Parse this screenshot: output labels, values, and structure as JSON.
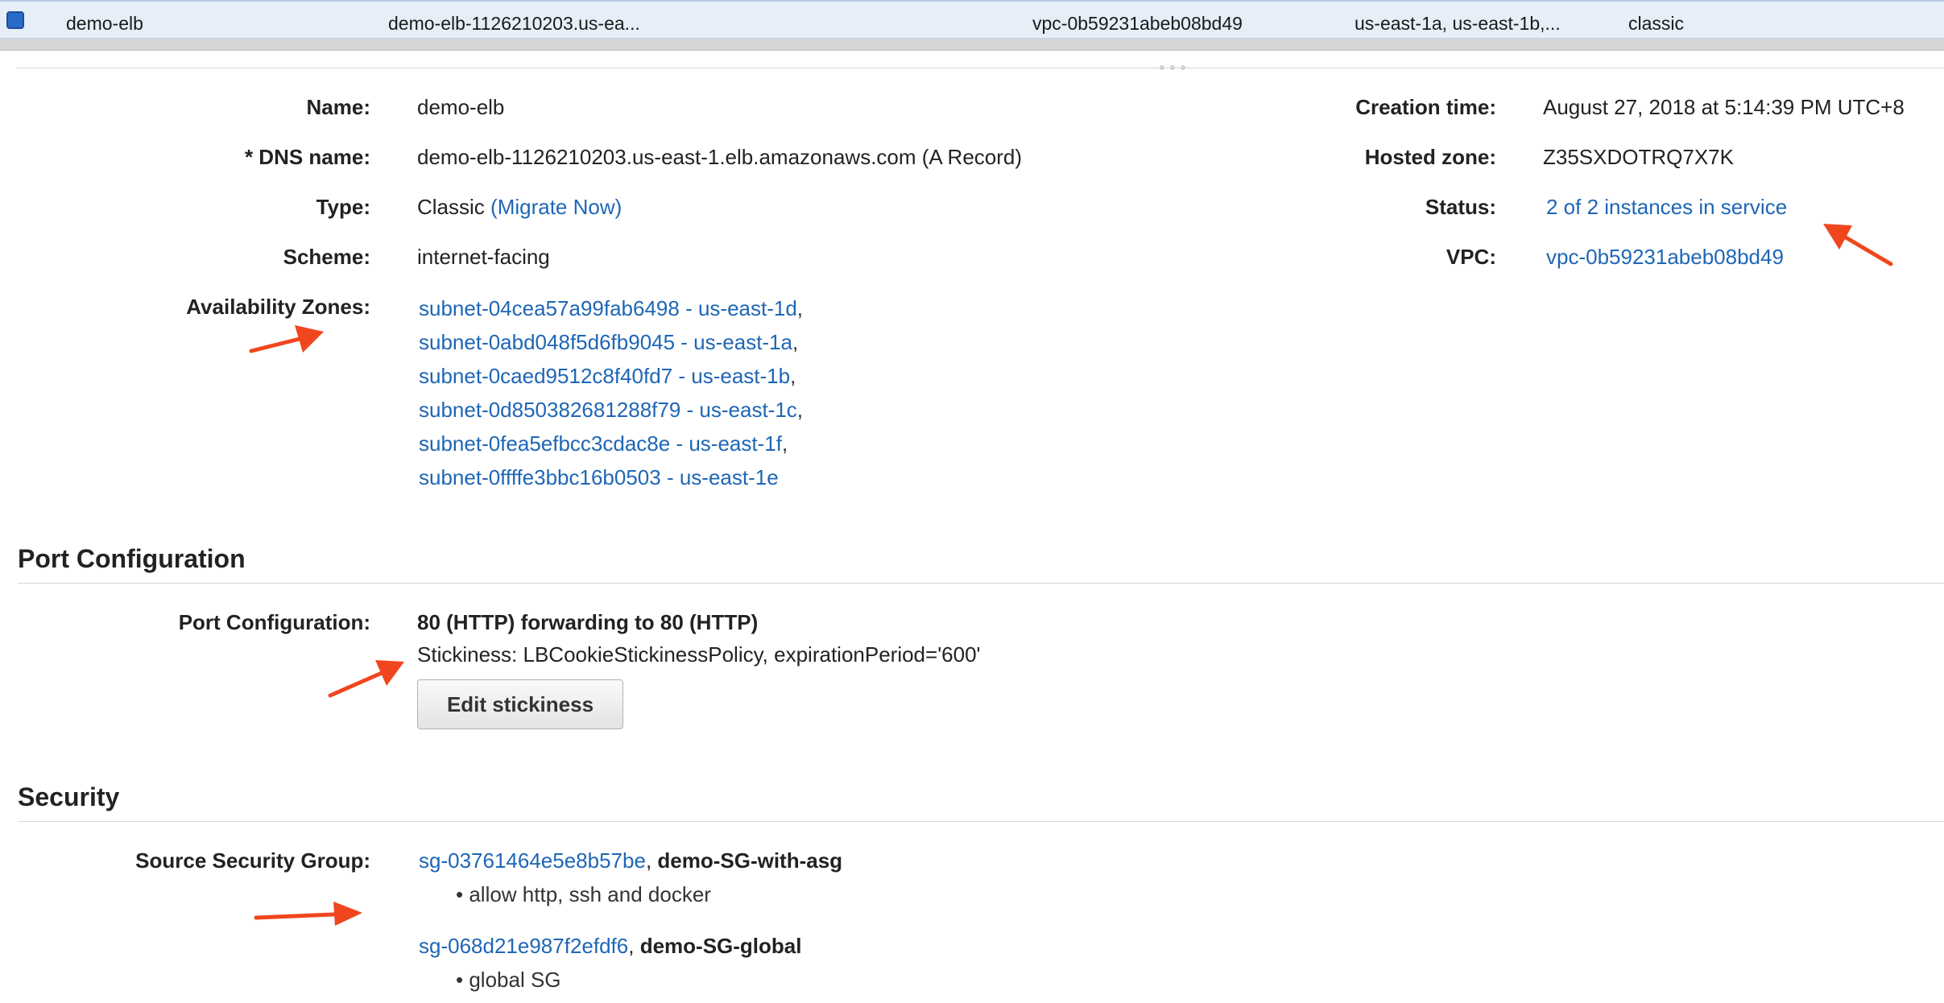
{
  "list_row": {
    "name": "demo-elb",
    "dns": "demo-elb-1126210203.us-ea...",
    "vpc": "vpc-0b59231abeb08bd49",
    "zones": "us-east-1a, us-east-1b,...",
    "type": "classic"
  },
  "drag_handle": "∘∘∘",
  "fields": {
    "name": {
      "label": "Name:",
      "value": "demo-elb"
    },
    "dns": {
      "label": "* DNS name:",
      "value": "demo-elb-1126210203.us-east-1.elb.amazonaws.com (A Record)"
    },
    "type": {
      "label": "Type:",
      "value": "Classic",
      "link": "(Migrate Now)"
    },
    "scheme": {
      "label": "Scheme:",
      "value": "internet-facing"
    },
    "availability_zones": {
      "label": "Availability Zones:",
      "items": [
        {
          "text": "subnet-04cea57a99fab6498 - us-east-1d",
          "sep": ","
        },
        {
          "text": "subnet-0abd048f5d6fb9045 - us-east-1a",
          "sep": ","
        },
        {
          "text": "subnet-0caed9512c8f40fd7 - us-east-1b",
          "sep": ","
        },
        {
          "text": "subnet-0d850382681288f79 - us-east-1c",
          "sep": ","
        },
        {
          "text": "subnet-0fea5efbcc3cdac8e - us-east-1f",
          "sep": ","
        },
        {
          "text": "subnet-0ffffe3bbc16b0503 - us-east-1e",
          "sep": ""
        }
      ]
    },
    "creation_time": {
      "label": "Creation time:",
      "value": "August 27, 2018 at 5:14:39 PM UTC+8"
    },
    "hosted_zone": {
      "label": "Hosted zone:",
      "value": "Z35SXDOTRQ7X7K"
    },
    "status": {
      "label": "Status:",
      "value": "2 of 2 instances in service"
    },
    "vpc": {
      "label": "VPC:",
      "value": "vpc-0b59231abeb08bd49"
    }
  },
  "port_configuration": {
    "section_title": "Port Configuration",
    "label": "Port Configuration:",
    "rule": "80 (HTTP) forwarding to 80 (HTTP)",
    "stickiness": "Stickiness: LBCookieStickinessPolicy, expirationPeriod='600'",
    "edit_button": "Edit stickiness"
  },
  "security": {
    "section_title": "Security",
    "label": "Source Security Group:",
    "groups": [
      {
        "id": "sg-03761464e5e8b57be",
        "sep": ", ",
        "name": "demo-SG-with-asg",
        "desc": "• allow http, ssh and docker"
      },
      {
        "id": "sg-068d21e987f2efdf6",
        "sep": ", ",
        "name": "demo-SG-global",
        "desc": "• global SG"
      }
    ]
  },
  "colors": {
    "link": "#1e66b6",
    "annotation_arrow": "#f0461e",
    "selected_row": "#e6eef8"
  }
}
